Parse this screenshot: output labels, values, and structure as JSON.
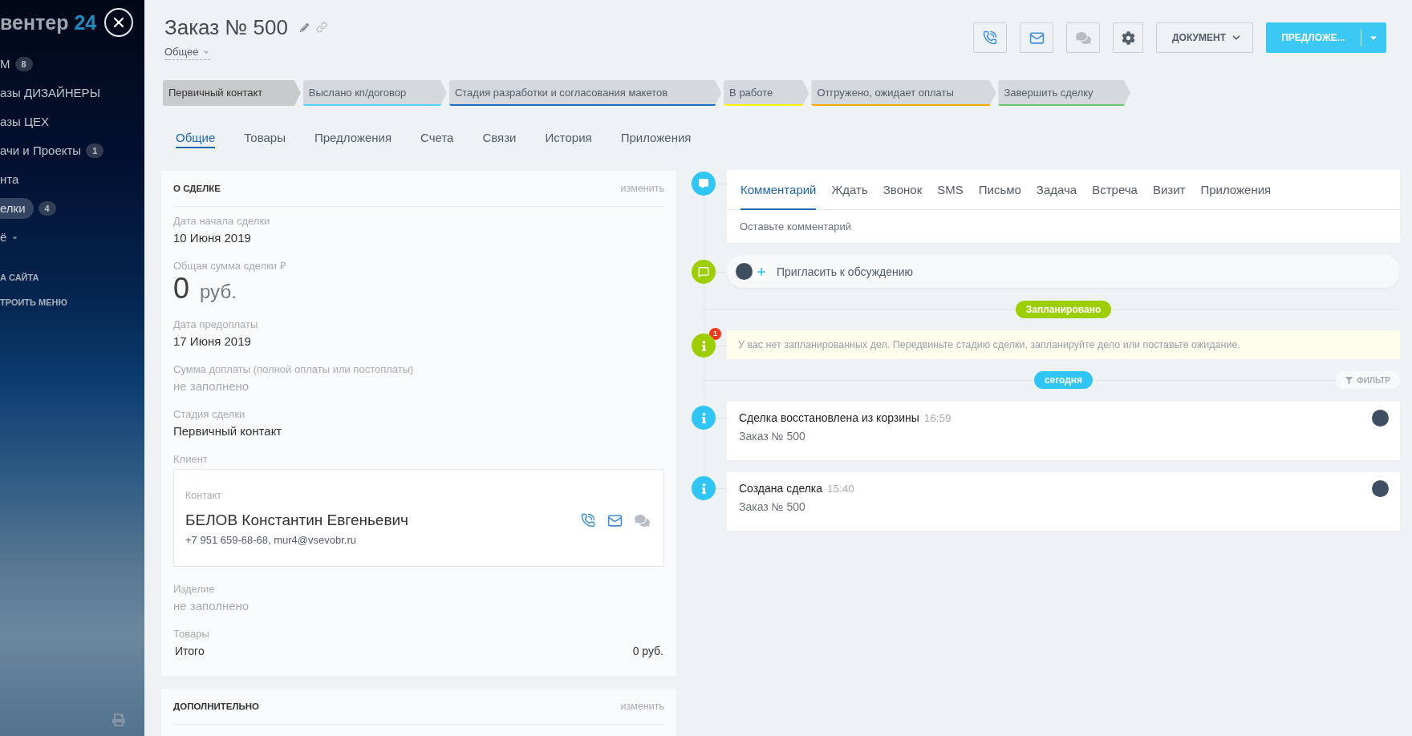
{
  "sidebar": {
    "brand": {
      "name": "вентер",
      "number": "24"
    },
    "items": [
      {
        "kind": "link",
        "label": "М",
        "counter": "8",
        "selected": false
      },
      {
        "kind": "link",
        "label": "азы ДИЗАЙНЕРЫ",
        "selected": false
      },
      {
        "kind": "link",
        "label": "азы ЦЕХ",
        "selected": false
      },
      {
        "kind": "link",
        "label": "ачи и Проекты",
        "counter": "1",
        "selected": false
      },
      {
        "kind": "link",
        "label": "нта",
        "selected": false
      },
      {
        "kind": "link",
        "label": "елки",
        "counter": "4",
        "selected": true
      },
      {
        "kind": "more",
        "label": "ё",
        "selected": false
      }
    ],
    "links": [
      "А САЙТА",
      "ТРОИТЬ МЕНЮ"
    ]
  },
  "header": {
    "title": "Заказ № 500",
    "category": "Общее",
    "actions": [
      {
        "kind": "phone",
        "disabled": false
      },
      {
        "kind": "mail",
        "disabled": false
      },
      {
        "kind": "chat",
        "disabled": true
      },
      {
        "kind": "settings"
      },
      {
        "kind": "menu",
        "label": "ДОКУМЕНТ"
      },
      {
        "kind": "split",
        "label": "ПРЕДЛОЖЕ..."
      }
    ]
  },
  "stages": [
    {
      "label": "Первичный контакт",
      "color": "#c9cacc",
      "selected": true
    },
    {
      "label": "Выслано кп/договор",
      "color": "#55d0f8",
      "selected": false
    },
    {
      "label": "Стадия разработки и согласования макетов",
      "color": "#1f6fc0",
      "selected": false
    },
    {
      "label": "В работе",
      "color": "#fff200",
      "selected": false
    },
    {
      "label": "Отгружено, ожидает оплаты",
      "color": "#ffa900",
      "selected": false
    },
    {
      "label": "Завершить сделку",
      "color": "#6cc46c",
      "selected": false
    }
  ],
  "tabs": [
    {
      "label": "Общие",
      "selected": true
    },
    {
      "label": "Товары",
      "selected": false
    },
    {
      "label": "Предложения",
      "selected": false
    },
    {
      "label": "Счета",
      "selected": false
    },
    {
      "label": "Связи",
      "selected": false
    },
    {
      "label": "История",
      "selected": false
    },
    {
      "label": "Приложения",
      "selected": false
    }
  ],
  "deal_card": {
    "title": "О СДЕЛКЕ",
    "edit_link": "изменить",
    "fields": [
      {
        "kind": "text",
        "label": "Дата начала сделки",
        "value": "10 Июня 2019"
      },
      {
        "kind": "money",
        "label": "Общая сумма сделки ₽",
        "amount": "0",
        "currency": "руб."
      },
      {
        "kind": "text",
        "label": "Дата предоплаты",
        "value": "17 Июня 2019"
      },
      {
        "kind": "empty",
        "label": "Сумма доплаты (полной оплаты или постоплаты)",
        "value": "не заполнено"
      },
      {
        "kind": "text",
        "label": "Стадия сделки",
        "value": "Первичный контакт"
      },
      {
        "kind": "client",
        "label": "Клиент",
        "contact": {
          "caption": "Контакт",
          "name": "БЕЛОВ Константин Евгеньевич",
          "details": "+7 951 659-68-68, mur4@vsevobr.ru",
          "actions": [
            {
              "kind": "phone",
              "disabled": false
            },
            {
              "kind": "mail",
              "disabled": false
            },
            {
              "kind": "chat",
              "disabled": true
            }
          ]
        }
      },
      {
        "kind": "empty",
        "label": "Изделие",
        "value": "не заполнено"
      },
      {
        "kind": "products",
        "label": "Товары",
        "total_label": "Итого",
        "total": "0 руб."
      }
    ]
  },
  "extra_card": {
    "title": "ДОПОЛНИТЕЛЬНО",
    "edit_link": "изменить"
  },
  "timeline": {
    "editor": {
      "tabs": [
        {
          "label": "Комментарий",
          "selected": true
        },
        {
          "label": "Ждать",
          "selected": false
        },
        {
          "label": "Звонок",
          "selected": false
        },
        {
          "label": "SMS",
          "selected": false
        },
        {
          "label": "Письмо",
          "selected": false
        },
        {
          "label": "Задача",
          "selected": false
        },
        {
          "label": "Встреча",
          "selected": false
        },
        {
          "label": "Визит",
          "selected": false
        },
        {
          "label": "Приложения",
          "selected": false
        }
      ],
      "placeholder": "Оставьте комментарий"
    },
    "invite": "Пригласить к обсуждению",
    "planned": {
      "label": "Запланировано",
      "badge": "1",
      "notice": "У вас нет запланированных дел. Передвиньте стадию сделки, запланируйте дело или поставьте ожидание."
    },
    "today": {
      "label": "сегодня",
      "filter": "ФИЛЬТР"
    },
    "events": [
      {
        "title": "Сделка восстановлена из корзины",
        "time": "16:59",
        "text": "Заказ № 500"
      },
      {
        "title": "Создана сделка",
        "time": "15:40",
        "text": "Заказ № 500"
      }
    ]
  }
}
